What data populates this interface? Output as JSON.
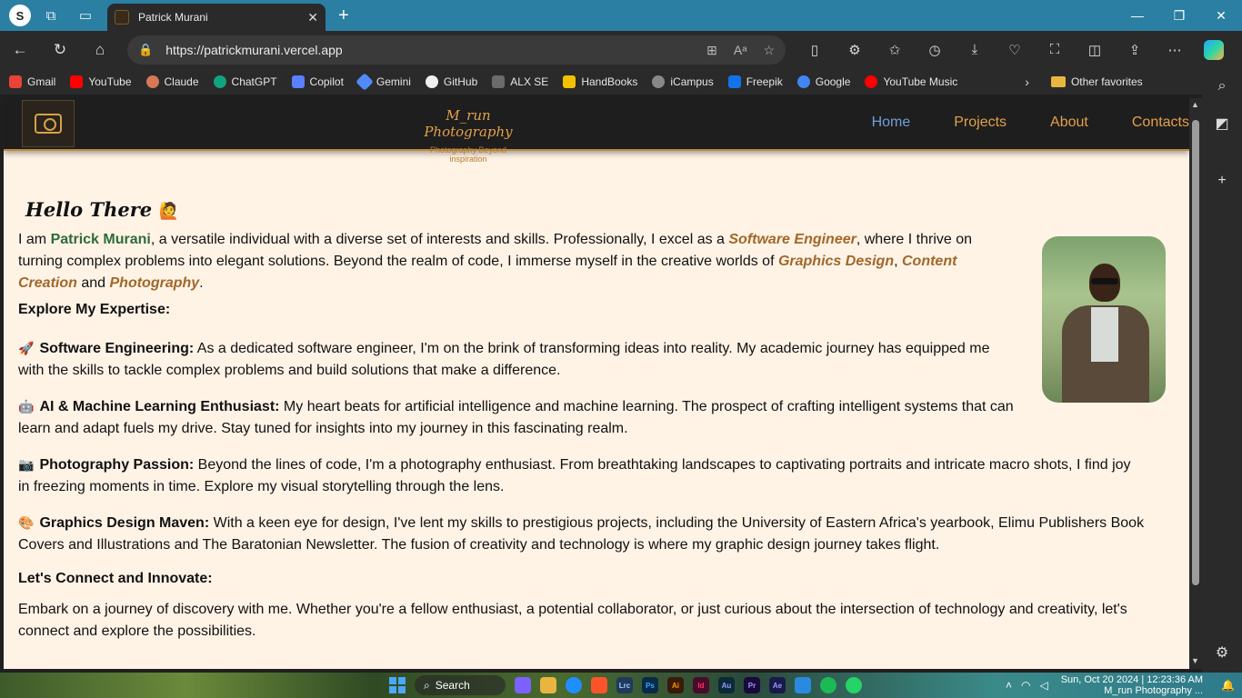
{
  "browser": {
    "profile_initial": "S",
    "tab_title": "Patrick Murani",
    "tab_close": "✕",
    "new_tab": "+",
    "url": "https://patrickmurani.vercel.app",
    "win_min": "—",
    "win_max": "❐",
    "win_close": "✕"
  },
  "favorites": [
    {
      "label": "Gmail",
      "color": "#ea4335"
    },
    {
      "label": "YouTube",
      "color": "#ff0000"
    },
    {
      "label": "Claude",
      "color": "#d97757"
    },
    {
      "label": "ChatGPT",
      "color": "#10a37f"
    },
    {
      "label": "Copilot",
      "color": "#5a7fff"
    },
    {
      "label": "Gemini",
      "color": "#4f8bf9"
    },
    {
      "label": "GitHub",
      "color": "#f0f0f0"
    },
    {
      "label": "ALX SE",
      "color": "#6b6b6b"
    },
    {
      "label": "HandBooks",
      "color": "#f2c200"
    },
    {
      "label": "iCampus",
      "color": "#888888"
    },
    {
      "label": "Freepik",
      "color": "#1273eb"
    },
    {
      "label": "Google",
      "color": "#4285f4"
    },
    {
      "label": "YouTube Music",
      "color": "#ff0000"
    }
  ],
  "favorites_other": "Other favorites",
  "site": {
    "brand_name": "M_run Photography",
    "brand_tag": "Photography Beyond inspiration",
    "nav": [
      {
        "label": "Home",
        "active": true
      },
      {
        "label": "Projects",
        "active": false
      },
      {
        "label": "About",
        "active": false
      },
      {
        "label": "Contacts",
        "active": false
      }
    ]
  },
  "page": {
    "hello": "Hello There",
    "hello_emoji": "🙋",
    "intro": {
      "p1": "I am ",
      "name": "Patrick Murani",
      "p2": ", a versatile individual with a diverse set of interests and skills. Professionally, I excel as a ",
      "skill1": "Software Engineer",
      "p3": ", where I thrive on turning complex problems into elegant solutions. Beyond the realm of code, I immerse myself in the creative worlds of ",
      "skill2": "Graphics Design",
      "p4": ", ",
      "skill3": "Content Creation",
      "p5": " and ",
      "skill4": "Photography",
      "p6": "."
    },
    "expertise_heading": "Explore My Expertise:",
    "items": [
      {
        "emoji": "🚀",
        "title": "Software Engineering:",
        "text": " As a dedicated software engineer, I'm on the brink of transforming ideas into reality. My academic journey has equipped me with the skills to tackle complex problems and build solutions that make a difference."
      },
      {
        "emoji": "🤖",
        "title": "AI & Machine Learning Enthusiast:",
        "text": " My heart beats for artificial intelligence and machine learning. The prospect of crafting intelligent systems that can learn and adapt fuels my drive. Stay tuned for insights into my journey in this fascinating realm."
      },
      {
        "emoji": "📷",
        "title": "Photography Passion:",
        "text": " Beyond the lines of code, I'm a photography enthusiast. From breathtaking landscapes to captivating portraits and intricate macro shots, I find joy in freezing moments in time. Explore my visual storytelling through the lens."
      },
      {
        "emoji": "🎨",
        "title": "Graphics Design Maven:",
        "text": " With a keen eye for design, I've lent my skills to prestigious projects, including the University of Eastern Africa's yearbook, Elimu Publishers Book Covers and Illustrations and The Baratonian Newsletter. The fusion of creativity and technology is where my graphic design journey takes flight."
      }
    ],
    "connect_heading": "Let's Connect and Innovate:",
    "connect_text": "Embark on a journey of discovery with me. Whether you're a fellow enthusiast, a potential collaborator, or just curious about the intersection of technology and creativity, let's connect and explore the possibilities."
  },
  "taskbar": {
    "search_label": "Search",
    "apps": [
      {
        "label": "",
        "color": "#7b61ff"
      },
      {
        "label": "",
        "color": "#e8b640"
      },
      {
        "label": "",
        "color": "#1f8fff"
      },
      {
        "label": "",
        "color": "#fb542b"
      },
      {
        "label": "Lrc",
        "color": "#1f3a5a"
      },
      {
        "label": "Ps",
        "color": "#0a2a4a"
      },
      {
        "label": "Ai",
        "color": "#3a1a0a"
      },
      {
        "label": "Id",
        "color": "#4a0a2a"
      },
      {
        "label": "Au",
        "color": "#0a2a3a"
      },
      {
        "label": "Pr",
        "color": "#1a0a3a"
      },
      {
        "label": "Ae",
        "color": "#1a1a4a"
      },
      {
        "label": "",
        "color": "#2a8ae0"
      },
      {
        "label": "",
        "color": "#1db954"
      },
      {
        "label": "",
        "color": "#25d366"
      }
    ],
    "clock": "Sun, Oct 20 2024 | 12:23:36 AM",
    "clock_sub": "M_run Photography ..."
  }
}
